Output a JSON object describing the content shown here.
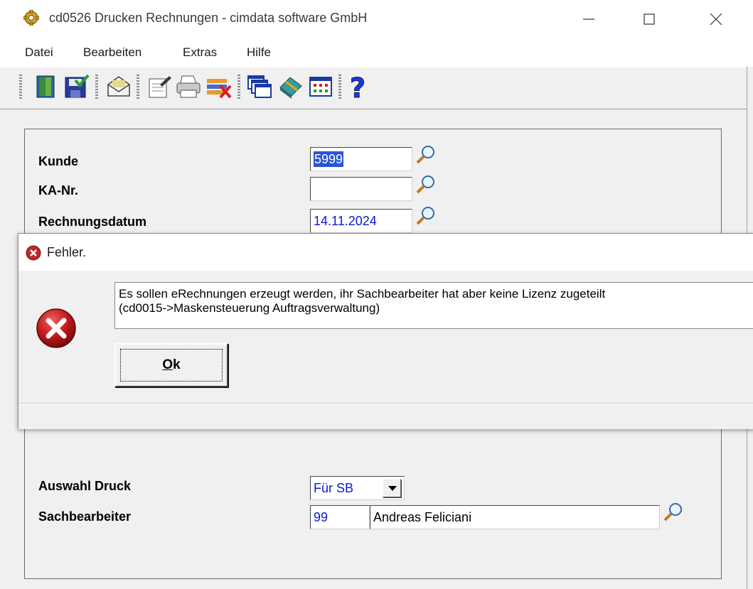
{
  "window": {
    "title": "cd0526 Drucken Rechnungen - cimdata software GmbH",
    "icon": "gear-icon",
    "controls": [
      "minimize-icon",
      "maximize-icon",
      "close-icon"
    ]
  },
  "menu": {
    "items": [
      "Datei",
      "Bearbeiten",
      "Extras",
      "Hilfe"
    ]
  },
  "toolbar": {
    "buttons": [
      "exit-door-icon",
      "save-check-icon",
      "envelope-icon",
      "notepad-icon",
      "printer-icon",
      "delete-list-icon",
      "windows-icon",
      "eraser-icon",
      "grid-window-icon",
      "help-icon"
    ]
  },
  "form": {
    "kunde": {
      "label": "Kunde",
      "value": "5999"
    },
    "ka_nr": {
      "label": "KA-Nr.",
      "value": ""
    },
    "rechnungsdatum": {
      "label": "Rechnungsdatum",
      "value": "14.11.2024"
    },
    "auswahl_druck": {
      "label": "Auswahl Druck",
      "value": "Für SB"
    },
    "sachbearbeiter": {
      "label": "Sachbearbeiter",
      "code": "99",
      "name": "Andreas Feliciani"
    }
  },
  "dialog": {
    "title": "Fehler.",
    "message_line1": "Es sollen eRechnungen erzeugt werden, ihr Sachbearbeiter hat aber keine Lizenz zugeteilt",
    "message_line2": "(cd0015->Maskensteuerung Auftragsverwaltung)",
    "ok_label_mnemonic": "O",
    "ok_label_rest": "k",
    "icon": "error-icon"
  },
  "colors": {
    "field_text": "#0a1ad0",
    "selection": "#2a55d6",
    "error_red": "#c0282a"
  }
}
